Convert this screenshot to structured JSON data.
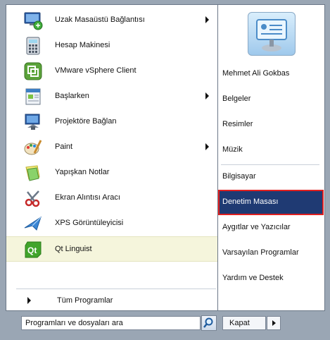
{
  "programs": [
    {
      "label": "Uzak Masaüstü Bağlantısı",
      "icon": "remote-desktop-icon",
      "has_submenu": true
    },
    {
      "label": "Hesap Makinesi",
      "icon": "calculator-icon",
      "has_submenu": false
    },
    {
      "label": "VMware vSphere Client",
      "icon": "vmware-icon",
      "has_submenu": false
    },
    {
      "label": "Başlarken",
      "icon": "getting-started-icon",
      "has_submenu": true
    },
    {
      "label": "Projektöre Bağlan",
      "icon": "projector-icon",
      "has_submenu": false
    },
    {
      "label": "Paint",
      "icon": "paint-icon",
      "has_submenu": true
    },
    {
      "label": "Yapışkan Notlar",
      "icon": "sticky-notes-icon",
      "has_submenu": false
    },
    {
      "label": "Ekran Alıntısı Aracı",
      "icon": "snipping-tool-icon",
      "has_submenu": false
    },
    {
      "label": "XPS Görüntüleyicisi",
      "icon": "xps-viewer-icon",
      "has_submenu": false
    },
    {
      "label": "Qt Linguist",
      "icon": "qt-linguist-icon",
      "has_submenu": false
    }
  ],
  "all_programs": "Tüm Programlar",
  "search": {
    "placeholder": "Programları ve dosyaları ara",
    "value": ""
  },
  "places": [
    {
      "label": "Mehmet Ali Gokbas"
    },
    {
      "label": "Belgeler"
    },
    {
      "label": "Resimler"
    },
    {
      "label": "Müzik"
    },
    {
      "label": "Bilgisayar"
    },
    {
      "label": "Denetim Masası",
      "selected": true
    },
    {
      "label": "Aygıtlar ve Yazıcılar"
    },
    {
      "label": "Varsayılan Programlar"
    },
    {
      "label": "Yardım ve Destek"
    }
  ],
  "shutdown": {
    "label": "Kapat"
  },
  "colors": {
    "selected_bg": "#1f3a73",
    "selected_border": "#e02020",
    "highlight_bg": "#f5f5dc"
  }
}
